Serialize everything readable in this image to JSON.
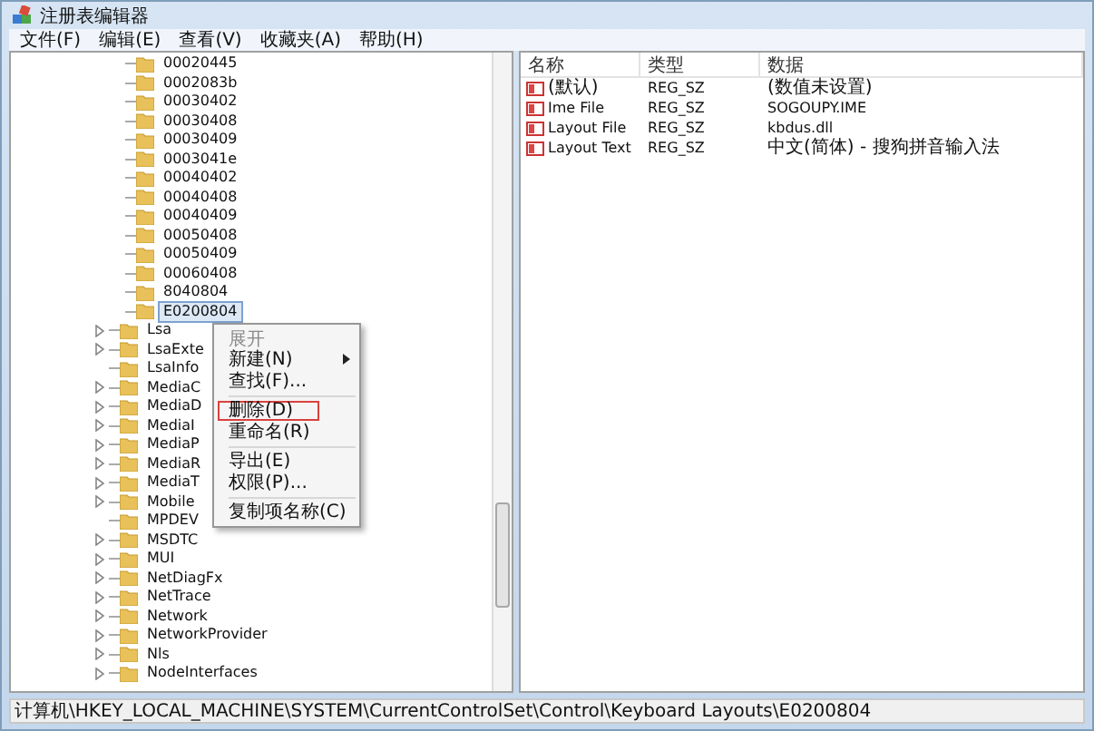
{
  "window": {
    "title": "注册表编辑器"
  },
  "menu": [
    "文件(F)",
    "编辑(E)",
    "查看(V)",
    "收藏夹(A)",
    "帮助(H)"
  ],
  "tree": {
    "open_key_children": [
      {
        "name": "00020445",
        "selected": false
      },
      {
        "name": "0002083b",
        "selected": false
      },
      {
        "name": "00030402",
        "selected": false
      },
      {
        "name": "00030408",
        "selected": false
      },
      {
        "name": "00030409",
        "selected": false
      },
      {
        "name": "0003041e",
        "selected": false
      },
      {
        "name": "00040402",
        "selected": false
      },
      {
        "name": "00040408",
        "selected": false
      },
      {
        "name": "00040409",
        "selected": false
      },
      {
        "name": "00050408",
        "selected": false
      },
      {
        "name": "00050409",
        "selected": false
      },
      {
        "name": "00060408",
        "selected": false
      },
      {
        "name": "8040804",
        "selected": false
      },
      {
        "name": "E0200804",
        "selected": true
      }
    ],
    "sibling_keys": [
      {
        "name": "Lsa",
        "expandable": true
      },
      {
        "name": "LsaExte",
        "expandable": true
      },
      {
        "name": "LsaInfo",
        "expandable": false
      },
      {
        "name": "MediaC",
        "expandable": true
      },
      {
        "name": "MediaD",
        "expandable": true
      },
      {
        "name": "MediaI",
        "expandable": true
      },
      {
        "name": "MediaP",
        "expandable": true
      },
      {
        "name": "MediaR",
        "expandable": true
      },
      {
        "name": "MediaT",
        "expandable": true
      },
      {
        "name": "Mobile",
        "expandable": true
      },
      {
        "name": "MPDEV",
        "expandable": false
      },
      {
        "name": "MSDTC",
        "expandable": true
      },
      {
        "name": "MUI",
        "expandable": true
      },
      {
        "name": "NetDiagFx",
        "expandable": true
      },
      {
        "name": "NetTrace",
        "expandable": true
      },
      {
        "name": "Network",
        "expandable": true
      },
      {
        "name": "NetworkProvider",
        "expandable": true
      },
      {
        "name": "Nls",
        "expandable": true
      },
      {
        "name": "NodeInterfaces",
        "expandable": true
      }
    ]
  },
  "context_menu": [
    {
      "kind": "item",
      "label": "展开",
      "disabled": true,
      "submenu": false,
      "selected": false
    },
    {
      "kind": "item",
      "label": "新建(N)",
      "disabled": false,
      "submenu": true,
      "selected": false
    },
    {
      "kind": "item",
      "label": "查找(F)...",
      "disabled": false,
      "submenu": false,
      "selected": false
    },
    {
      "kind": "separator"
    },
    {
      "kind": "item",
      "label": "删除(D)",
      "disabled": false,
      "submenu": false,
      "selected": true
    },
    {
      "kind": "item",
      "label": "重命名(R)",
      "disabled": false,
      "submenu": false,
      "selected": false
    },
    {
      "kind": "separator"
    },
    {
      "kind": "item",
      "label": "导出(E)",
      "disabled": false,
      "submenu": false,
      "selected": false
    },
    {
      "kind": "item",
      "label": "权限(P)...",
      "disabled": false,
      "submenu": false,
      "selected": false
    },
    {
      "kind": "separator"
    },
    {
      "kind": "item",
      "label": "复制项名称(C)",
      "disabled": false,
      "submenu": false,
      "selected": false
    }
  ],
  "values": {
    "columns": [
      "名称",
      "类型",
      "数据"
    ],
    "rows": [
      [
        "(默认)",
        "REG_SZ",
        "(数值未设置)"
      ],
      [
        "Ime File",
        "REG_SZ",
        "SOGOUPY.IME"
      ],
      [
        "Layout File",
        "REG_SZ",
        "kbdus.dll"
      ],
      [
        "Layout Text",
        "REG_SZ",
        "中文(简体) - 搜狗拼音输入法"
      ]
    ]
  },
  "status_bar": "计算机\\HKEY_LOCAL_MACHINE\\SYSTEM\\CurrentControlSet\\Control\\Keyboard Layouts\\E0200804"
}
